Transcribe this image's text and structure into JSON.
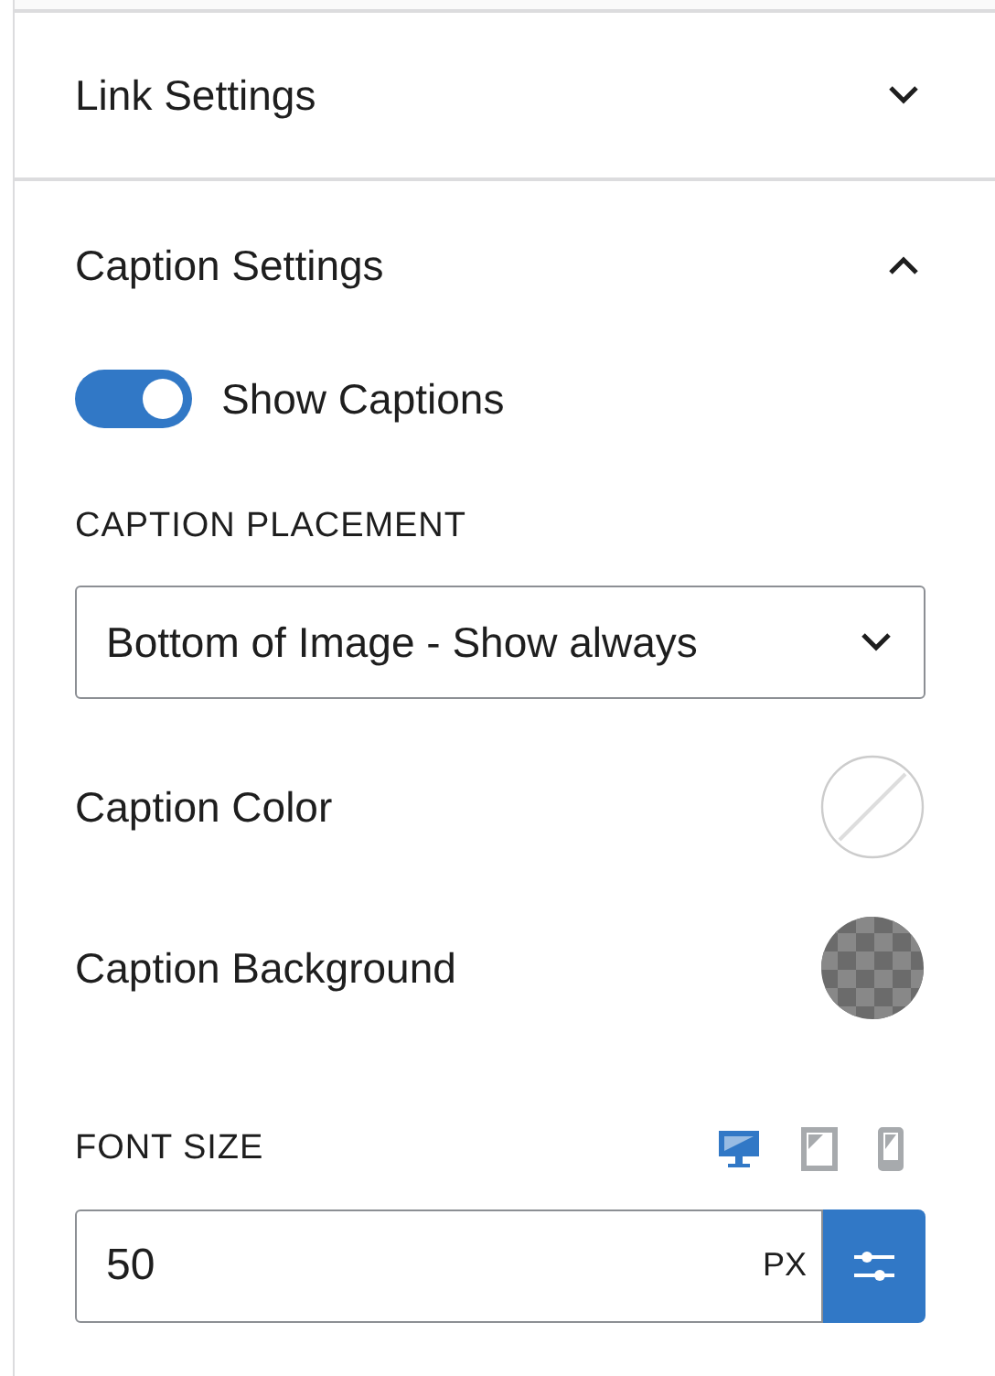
{
  "sections": [
    {
      "title": "Link Settings",
      "expanded": false
    },
    {
      "title": "Caption Settings",
      "expanded": true
    }
  ],
  "toggle": {
    "label": "Show Captions",
    "on": true
  },
  "placement": {
    "label": "CAPTION PLACEMENT",
    "value": "Bottom of Image - Show always"
  },
  "color_rows": [
    {
      "label": "Caption Color",
      "kind": "none"
    },
    {
      "label": "Caption Background",
      "kind": "checker"
    }
  ],
  "font_size": {
    "label": "FONT SIZE",
    "value": "50",
    "unit": "PX",
    "devices": [
      {
        "kind": "desktop",
        "selected": true
      },
      {
        "kind": "tablet",
        "selected": false
      },
      {
        "kind": "mobile",
        "selected": false
      }
    ]
  }
}
